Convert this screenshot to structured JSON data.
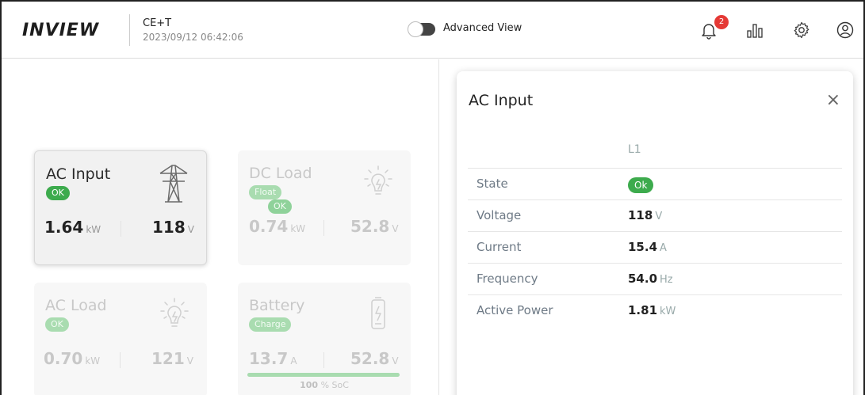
{
  "header": {
    "logo": "INVIEW",
    "site_name": "CE+T",
    "timestamp": "2023/09/12 06:42:06",
    "advanced_view_label": "Advanced View",
    "notification_count": "2"
  },
  "cards": {
    "ac_input": {
      "title": "AC Input",
      "status": "OK",
      "power": "1.64",
      "power_unit": "kW",
      "voltage": "118",
      "voltage_unit": "V"
    },
    "dc_load": {
      "title": "DC Load",
      "status": "Float",
      "status2": "OK",
      "power": "0.74",
      "power_unit": "kW",
      "voltage": "52.8",
      "voltage_unit": "V"
    },
    "ac_load": {
      "title": "AC Load",
      "status": "OK",
      "power": "0.70",
      "power_unit": "kW",
      "voltage": "121",
      "voltage_unit": "V"
    },
    "battery": {
      "title": "Battery",
      "status": "Charge",
      "current": "13.7",
      "current_unit": "A",
      "voltage": "52.8",
      "voltage_unit": "V",
      "soc_value": "100",
      "soc_unit": "% SoC",
      "soc_fraction": 1.0
    }
  },
  "panel": {
    "title": "AC Input",
    "column": "L1",
    "rows": [
      {
        "label": "State",
        "value": "Ok",
        "unit": ""
      },
      {
        "label": "Voltage",
        "value": "118",
        "unit": "V"
      },
      {
        "label": "Current",
        "value": "15.4",
        "unit": "A"
      },
      {
        "label": "Frequency",
        "value": "54.0",
        "unit": "Hz"
      },
      {
        "label": "Active Power",
        "value": "1.81",
        "unit": "kW"
      }
    ]
  },
  "icons": {
    "bell": "bell-icon",
    "chart": "bar-chart-icon",
    "settings": "gear-icon",
    "user": "user-icon",
    "close": "close-icon"
  },
  "colors": {
    "ok_green": "#3dab4d",
    "badge_red": "#e53935"
  }
}
